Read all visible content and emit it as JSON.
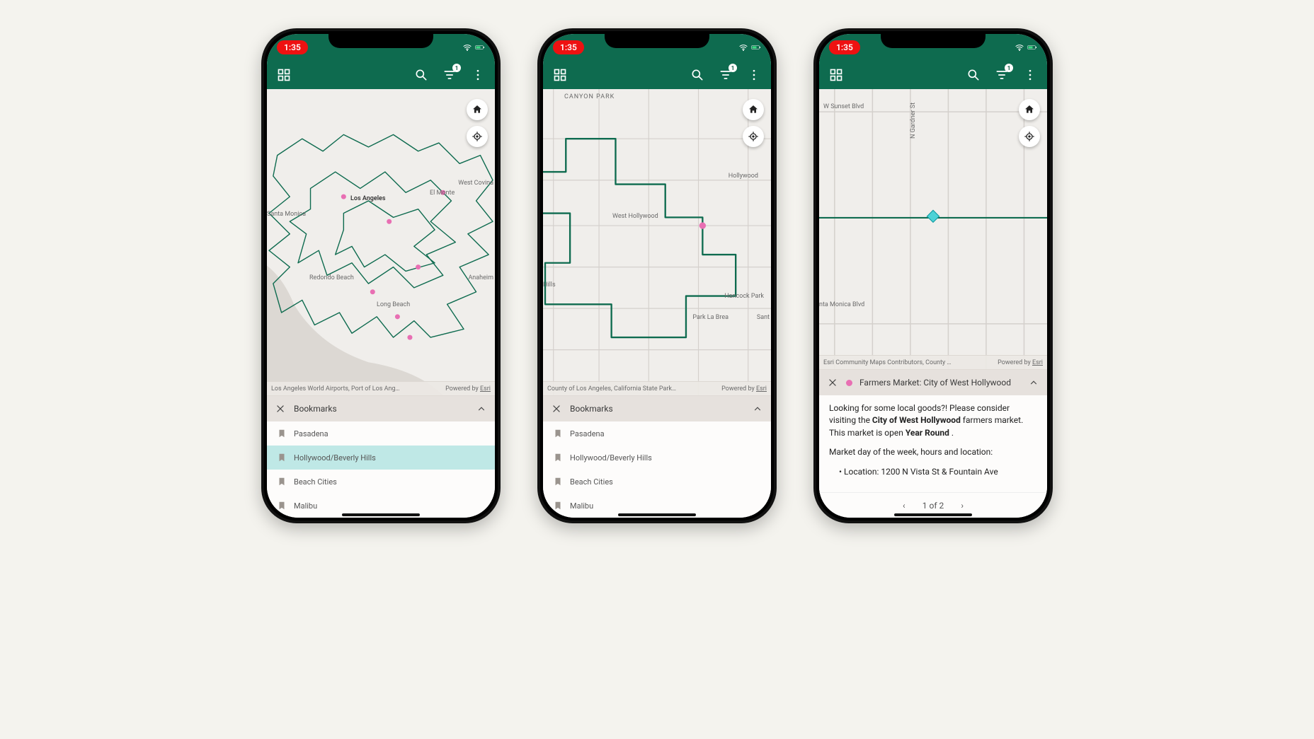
{
  "status": {
    "time": "1:35"
  },
  "appbar": {
    "filter_badge": "1"
  },
  "attribution": {
    "powered_prefix": "Powered by ",
    "powered_link": "Esri",
    "phone1": "Los Angeles World Airports, Port of Los Ang…",
    "phone2": "County of Los Angeles, California State Park…",
    "phone3": "Esri Community Maps Contributors, County …"
  },
  "panel": {
    "bookmarks_title": "Bookmarks",
    "bookmarks": [
      {
        "label": "Pasadena"
      },
      {
        "label": "Hollywood/Beverly Hills"
      },
      {
        "label": "Beach Cities"
      },
      {
        "label": "Malibu"
      }
    ],
    "popup": {
      "title": "Farmers Market: City of West Hollywood",
      "p1_a": "Looking for some local goods?! Please consider visiting the ",
      "p1_b_bold": "City of West Hollywood",
      "p1_c": " farmers market. This market is open ",
      "p1_d_bold": "Year Round",
      "p1_e": " .",
      "p2": "Market day of the week, hours and location:",
      "li1": "• Location: 1200 N Vista St & Fountain Ave",
      "pager": "1 of 2"
    }
  },
  "map_labels": {
    "p1": {
      "la": "Los Angeles",
      "santa_monica": "Santa Monica",
      "redondo": "Redondo Beach",
      "long_beach": "Long Beach",
      "anaheim": "Anaheim",
      "covina": "West Covina",
      "monte": "El Monte"
    },
    "p2": {
      "canyon": "CANYON PARK",
      "west_hw": "West Hollywood",
      "hollywood": "Hollywood",
      "hancock": "Hancock Park",
      "labrea": "Park La Brea",
      "hills": "Hills",
      "sant": "Sant"
    },
    "p3": {
      "sunset": "W Sunset Blvd",
      "gardner": "N Gardner St",
      "monica": "nta Monica Blvd"
    }
  }
}
